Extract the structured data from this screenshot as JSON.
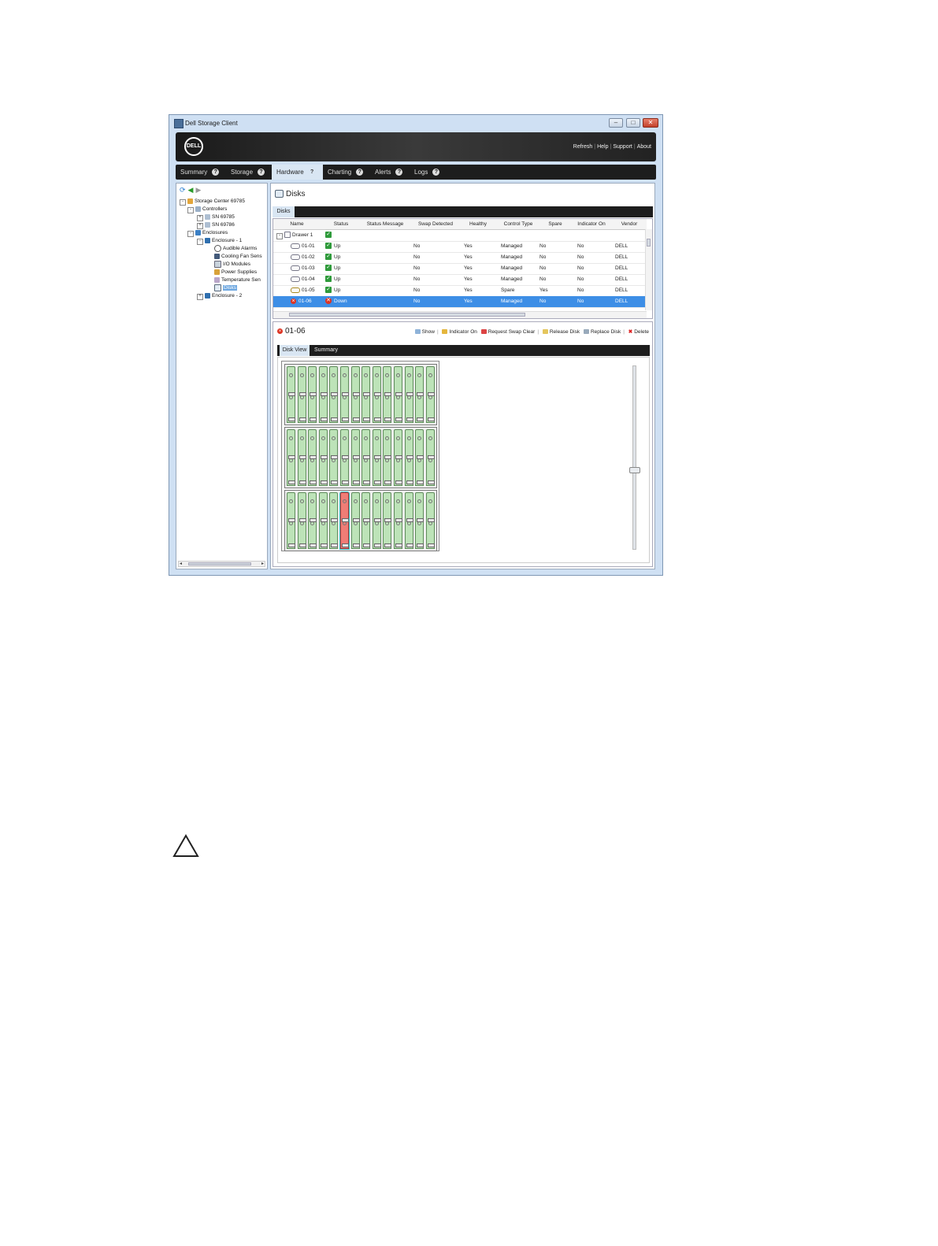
{
  "window": {
    "title": "Dell Storage Client",
    "controls": {
      "minimize": "–",
      "maximize": "□",
      "close": "✕"
    }
  },
  "banner": {
    "logo_text": "DELL",
    "links": [
      "Refresh",
      "Help",
      "Support",
      "About"
    ]
  },
  "tabs": [
    {
      "label": "Summary",
      "help": "?"
    },
    {
      "label": "Storage",
      "help": "?"
    },
    {
      "label": "Hardware",
      "help": "?",
      "active": true
    },
    {
      "label": "Charting",
      "help": "?"
    },
    {
      "label": "Alerts",
      "help": "?"
    },
    {
      "label": "Logs",
      "help": "?"
    }
  ],
  "navigation": {
    "refresh_icon": "refresh-icon",
    "back_icon": "back-arrow-icon",
    "forward_icon": "forward-arrow-icon"
  },
  "tree": [
    {
      "label": "Storage Center 69785",
      "icon": "storage-center-icon",
      "expander": "-"
    },
    {
      "label": "Controllers",
      "icon": "controllers-icon",
      "expander": "-"
    },
    {
      "label": "SN 69785",
      "icon": "controller-icon",
      "expander": "+"
    },
    {
      "label": "SN 69786",
      "icon": "controller-icon",
      "expander": "+"
    },
    {
      "label": "Enclosures",
      "icon": "enclosures-icon",
      "expander": "-"
    },
    {
      "label": "Enclosure - 1",
      "icon": "enclosure-icon",
      "expander": "-"
    },
    {
      "label": "Audible Alarms",
      "icon": "alarm-icon"
    },
    {
      "label": "Cooling Fan Sens",
      "icon": "fan-icon"
    },
    {
      "label": "I/O Modules",
      "icon": "io-module-icon"
    },
    {
      "label": "Power Supplies",
      "icon": "power-supply-icon"
    },
    {
      "label": "Temperature Sen",
      "icon": "temperature-icon"
    },
    {
      "label": "Disks",
      "icon": "disks-icon",
      "selected": true
    },
    {
      "label": "Enclosure - 2",
      "icon": "enclosure-icon",
      "expander": "+"
    }
  ],
  "panel": {
    "title": "Disks",
    "subtab": "Disks"
  },
  "table": {
    "columns": [
      "Name",
      "Status",
      "Status Message",
      "Swap Detected",
      "Healthy",
      "Control Type",
      "Spare",
      "Indicator On",
      "Vendor"
    ],
    "group": {
      "name": "Drawer 1",
      "expander": "-"
    },
    "rows": [
      {
        "name": "01-01",
        "status": "Up",
        "swap": "No",
        "healthy": "Yes",
        "control": "Managed",
        "spare": "No",
        "indicator": "No",
        "vendor": "DELL"
      },
      {
        "name": "01-02",
        "status": "Up",
        "swap": "No",
        "healthy": "Yes",
        "control": "Managed",
        "spare": "No",
        "indicator": "No",
        "vendor": "DELL"
      },
      {
        "name": "01-03",
        "status": "Up",
        "swap": "No",
        "healthy": "Yes",
        "control": "Managed",
        "spare": "No",
        "indicator": "No",
        "vendor": "DELL"
      },
      {
        "name": "01-04",
        "status": "Up",
        "swap": "No",
        "healthy": "Yes",
        "control": "Managed",
        "spare": "No",
        "indicator": "No",
        "vendor": "DELL"
      },
      {
        "name": "01-05",
        "status": "Up",
        "swap": "No",
        "healthy": "Yes",
        "control": "Spare",
        "spare": "Yes",
        "indicator": "No",
        "vendor": "DELL"
      },
      {
        "name": "01-06",
        "status": "Down",
        "swap": "No",
        "healthy": "Yes",
        "control": "Managed",
        "spare": "No",
        "indicator": "No",
        "vendor": "DELL",
        "selected": true
      }
    ]
  },
  "detail": {
    "title": "01-06",
    "actions": [
      "Show",
      "Indicator On",
      "Request Swap Clear",
      "Release Disk",
      "Replace Disk",
      "Delete"
    ],
    "tabs": [
      "Disk View",
      "Summary"
    ],
    "active_tab": "Disk View"
  },
  "enclosure": {
    "drawers": 3,
    "bays_per_drawer": 14,
    "failed_bay": {
      "drawer": 3,
      "bay": 6
    },
    "colors": {
      "healthy": "#bde3b8",
      "failed": "#ef7d76",
      "highlight": "#3bc6c9"
    }
  },
  "colors": {
    "tab_active": "#d9e6f3",
    "selection": "#3d8ee6",
    "status_ok": "#2e9a3a",
    "status_error": "#dd3322"
  },
  "page": {
    "caution_icon": "caution-triangle-icon"
  }
}
